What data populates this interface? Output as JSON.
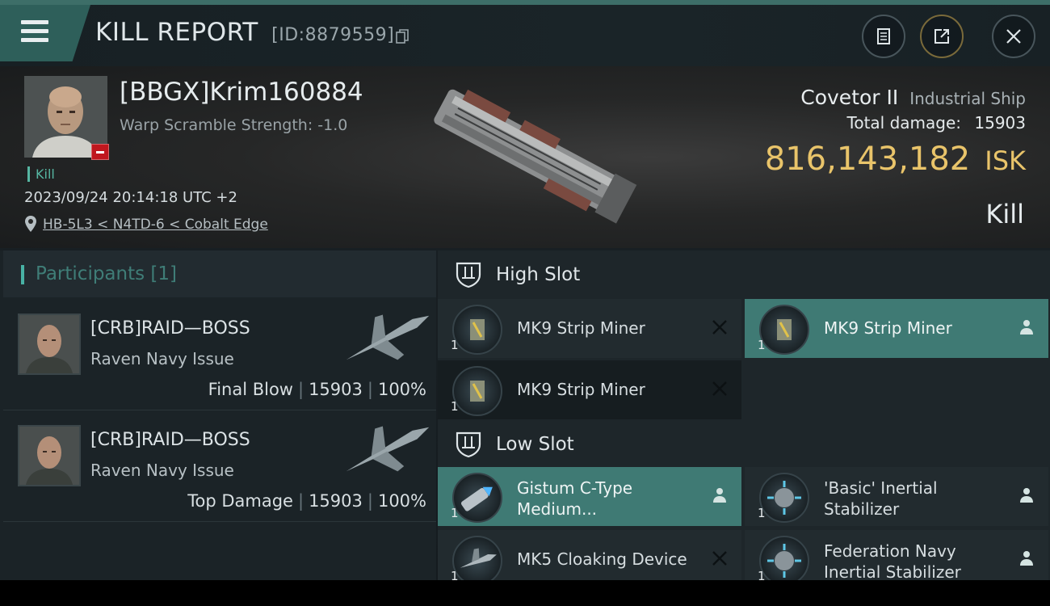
{
  "header": {
    "title": "KILL REPORT",
    "report_id": "[ID:8879559]",
    "icons": [
      "menu-icon",
      "copy-icon",
      "notes-icon",
      "share-icon",
      "close-icon"
    ]
  },
  "victim": {
    "name": "[BBGX]Krim160884",
    "warp_scramble": "Warp Scramble Strength: -1.0",
    "tag": "Kill",
    "datetime": "2023/09/24 20:14:18 UTC +2",
    "location": "HB-5L3 < N4TD-6 < Cobalt Edge",
    "ship_name": "Covetor II",
    "ship_class": "Industrial Ship",
    "total_damage_label": "Total damage:",
    "total_damage": "15903",
    "isk_value": "816,143,182",
    "isk_unit": "ISK",
    "result": "Kill"
  },
  "participants": {
    "title": "Participants [1]",
    "rows": [
      {
        "name": "[CRB]RAID—BOSS",
        "ship": "Raven Navy Issue",
        "role": "Final Blow",
        "damage": "15903",
        "percent": "100%"
      },
      {
        "name": "[CRB]RAID—BOSS",
        "ship": "Raven Navy Issue",
        "role": "Top Damage",
        "damage": "15903",
        "percent": "100%"
      }
    ]
  },
  "slots": {
    "high": {
      "title": "High Slot",
      "items": [
        {
          "name": "MK9 Strip Miner",
          "qty": "1",
          "state": "destroyed"
        },
        {
          "name": "MK9 Strip Miner",
          "qty": "1",
          "state": "dropped"
        },
        {
          "name": "MK9 Strip Miner",
          "qty": "1",
          "state": "destroyed"
        }
      ]
    },
    "low": {
      "title": "Low Slot",
      "items": [
        {
          "name_line1": "Gistum C-Type",
          "name_line2": "Medium...",
          "qty": "1",
          "state": "dropped"
        },
        {
          "name_line1": "'Basic' Inertial",
          "name_line2": "Stabilizer",
          "qty": "1",
          "state": "dropped"
        },
        {
          "name": "MK5 Cloaking Device",
          "qty": "1",
          "state": "destroyed"
        },
        {
          "name_line1": "Federation Navy",
          "name_line2": "Inertial Stabilizer",
          "qty": "1",
          "state": "dropped"
        }
      ]
    }
  },
  "colors": {
    "accent_teal": "#3f7a74",
    "isk_gold": "#e9c46a",
    "badge_red": "#c0171e"
  }
}
